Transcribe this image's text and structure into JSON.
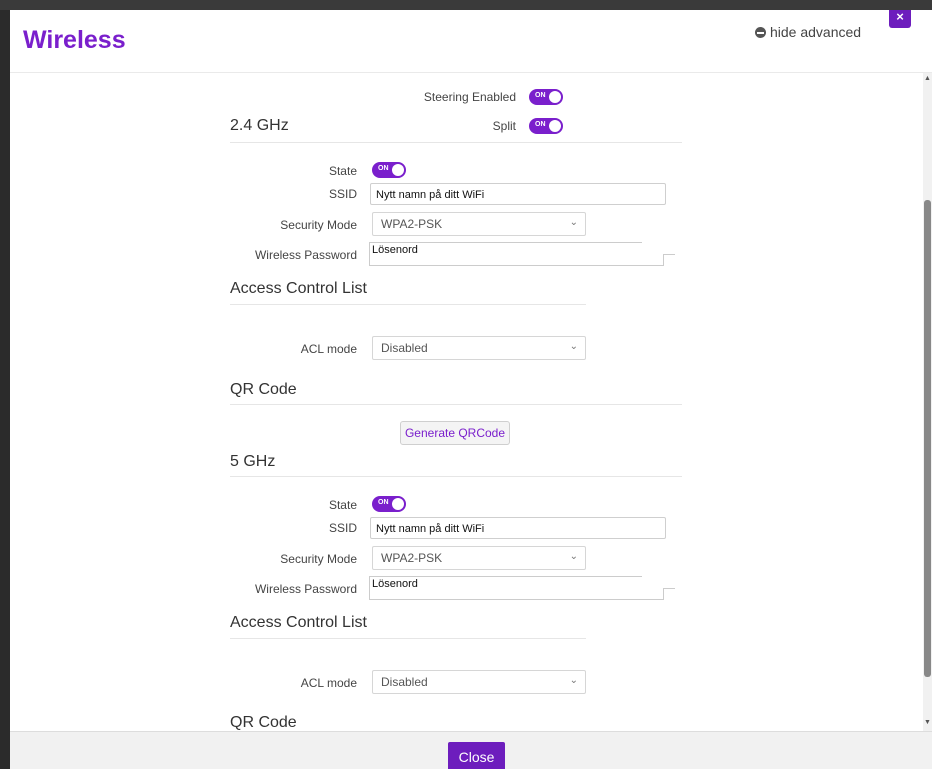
{
  "modal": {
    "title": "Wireless",
    "hide_advanced": "hide advanced",
    "close_x": "×",
    "footer_close": "Close"
  },
  "top": {
    "steering_label": "Steering Enabled",
    "split_label": "Split",
    "toggle_on": "ON"
  },
  "band24": {
    "title": "2.4 GHz",
    "state_label": "State",
    "ssid_label": "SSID",
    "ssid_value": "Nytt namn på ditt WiFi",
    "security_label": "Security Mode",
    "security_value": "WPA2-PSK",
    "password_label": "Wireless Password",
    "password_value": "Lösenord",
    "acl_title": "Access Control List",
    "acl_label": "ACL mode",
    "acl_value": "Disabled",
    "qr_title": "QR Code",
    "qr_button": "Generate QRCode"
  },
  "band5": {
    "title": "5 GHz",
    "state_label": "State",
    "ssid_label": "SSID",
    "ssid_value": "Nytt namn på ditt WiFi",
    "security_label": "Security Mode",
    "security_value": "WPA2-PSK",
    "password_label": "Wireless Password",
    "password_value": "Lösenord",
    "acl_title": "Access Control List",
    "acl_label": "ACL mode",
    "acl_value": "Disabled",
    "qr_title": "QR Code"
  },
  "icons": {
    "close": "close-icon",
    "minus": "minus-circle-icon",
    "chevron": "chevron-down-icon"
  },
  "colors": {
    "accent": "#7a1fcc",
    "button": "#6d1dbd"
  }
}
